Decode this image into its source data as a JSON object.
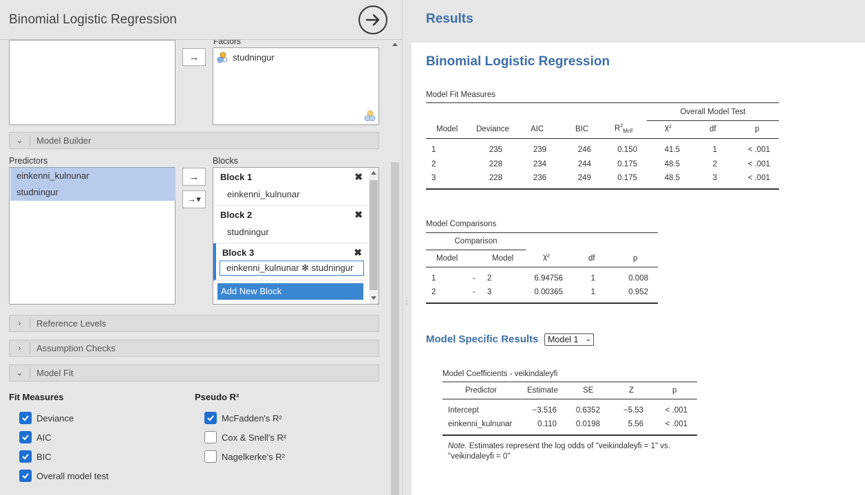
{
  "left_panel": {
    "title": "Binomial Logistic Regression",
    "factors_label": "Factors",
    "factors_items": [
      "studningur"
    ],
    "model_builder": {
      "section_label": "Model Builder",
      "predictors_label": "Predictors",
      "predictors": [
        "einkenni_kulnunar",
        "studningur"
      ],
      "blocks_label": "Blocks",
      "blocks": [
        {
          "title": "Block 1",
          "item": "einkenni_kulnunar"
        },
        {
          "title": "Block 2",
          "item": "studningur"
        },
        {
          "title": "Block 3",
          "item": "einkenni_kulnunar ✻ studningur"
        }
      ],
      "add_block_label": "Add New Block"
    },
    "sections": {
      "reference_levels": "Reference Levels",
      "assumption_checks": "Assumption Checks",
      "model_fit": "Model Fit"
    },
    "fit_measures": {
      "title": "Fit Measures",
      "items": [
        {
          "label": "Deviance",
          "checked": true
        },
        {
          "label": "AIC",
          "checked": true
        },
        {
          "label": "BIC",
          "checked": true
        },
        {
          "label": "Overall model test",
          "checked": true
        }
      ]
    },
    "pseudo_r2": {
      "title": "Pseudo R²",
      "items": [
        {
          "label": "McFadden's R²",
          "checked": true
        },
        {
          "label": "Cox & Snell's R²",
          "checked": false
        },
        {
          "label": "Nagelkerke's R²",
          "checked": false
        }
      ]
    }
  },
  "results": {
    "header": "Results",
    "analysis_title": "Binomial Logistic Regression",
    "model_fit": {
      "title": "Model Fit Measures",
      "group_header": "Overall Model Test",
      "columns": [
        "Model",
        "Deviance",
        "AIC",
        "BIC",
        "R²McF",
        "χ²",
        "df",
        "p"
      ],
      "rows": [
        [
          "1",
          "235",
          "239",
          "246",
          "0.150",
          "41.5",
          "1",
          "< .001"
        ],
        [
          "2",
          "228",
          "234",
          "244",
          "0.175",
          "48.5",
          "2",
          "< .001"
        ],
        [
          "3",
          "228",
          "236",
          "249",
          "0.175",
          "48.5",
          "3",
          "< .001"
        ]
      ]
    },
    "model_comparisons": {
      "title": "Model Comparisons",
      "group_header": "Comparison",
      "columns": [
        "Model",
        "Model",
        "χ²",
        "df",
        "p"
      ],
      "rows": [
        [
          "1",
          "-",
          "2",
          "6.94756",
          "1",
          "0.008"
        ],
        [
          "2",
          "-",
          "3",
          "0.00365",
          "1",
          "0.952"
        ]
      ]
    },
    "model_specific": {
      "title": "Model Specific Results",
      "selected_model": "Model 1",
      "coefficients_title": "Model Coefficients - veikindaleyfi",
      "columns": [
        "Predictor",
        "Estimate",
        "SE",
        "Z",
        "p"
      ],
      "rows": [
        [
          "Intercept",
          "−3.516",
          "0.6352",
          "−5.53",
          "< .001"
        ],
        [
          "einkenni_kulnunar",
          "0.110",
          "0.0198",
          "5.56",
          "< .001"
        ]
      ],
      "note_label": "Note.",
      "note_text": " Estimates represent the log odds of \"veikindaleyfi = 1\" vs. \"veikindaleyfi = 0\""
    }
  },
  "colors": {
    "accent": "#3e6ea8",
    "selection": "#b8cbed",
    "checkbox": "#1f6fd1",
    "button": "#3b86d1"
  }
}
